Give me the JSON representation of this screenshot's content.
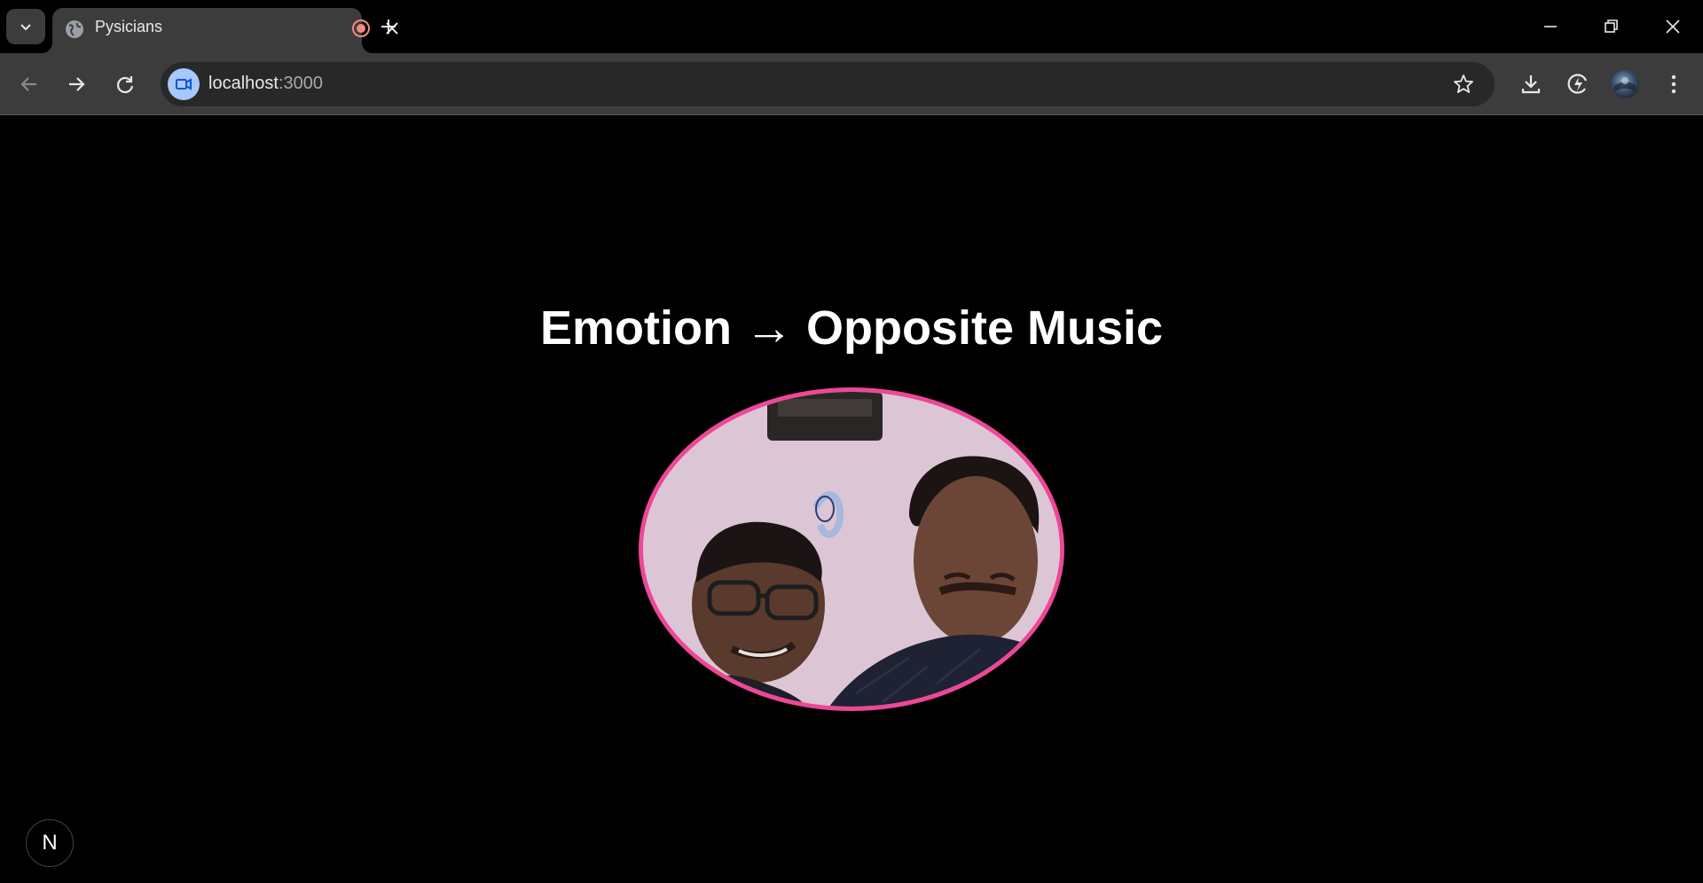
{
  "browser": {
    "tab": {
      "title": "Pysicians"
    },
    "address_bar": {
      "host": "localhost",
      "port": ":3000"
    }
  },
  "page": {
    "heading": "Emotion → Opposite Music",
    "accent_color": "#ee4797",
    "dev_badge": "N"
  }
}
